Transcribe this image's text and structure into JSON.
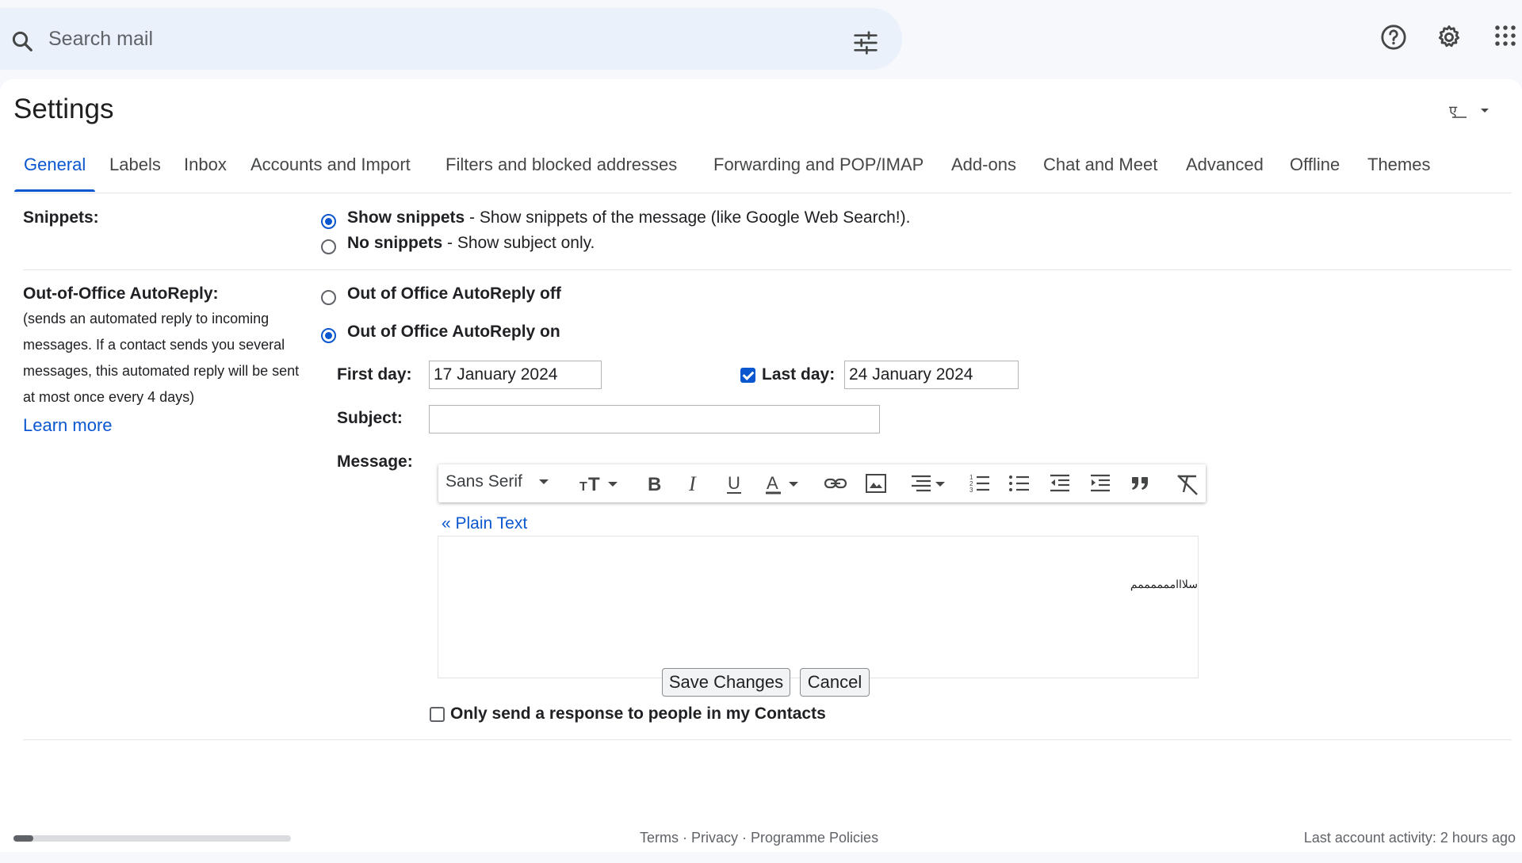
{
  "search": {
    "placeholder": "Search mail"
  },
  "header": {
    "icons": [
      "search-icon",
      "tune-icon",
      "help-icon",
      "gear-icon",
      "apps-icon"
    ]
  },
  "page": {
    "title": "Settings"
  },
  "tabs": [
    {
      "label": "General",
      "active": true
    },
    {
      "label": "Labels"
    },
    {
      "label": "Inbox"
    },
    {
      "label": "Accounts and Import"
    },
    {
      "label": "Filters and blocked addresses"
    },
    {
      "label": "Forwarding and POP/IMAP"
    },
    {
      "label": "Add-ons"
    },
    {
      "label": "Chat and Meet"
    },
    {
      "label": "Advanced"
    },
    {
      "label": "Offline"
    },
    {
      "label": "Themes"
    }
  ],
  "snippets": {
    "label": "Snippets:",
    "show": {
      "title": "Show snippets",
      "desc": " - Show snippets of the message (like Google Web Search!)."
    },
    "none": {
      "title": "No snippets",
      "desc": " - Show subject only."
    },
    "selected": "show"
  },
  "ooo": {
    "label": "Out-of-Office AutoReply:",
    "description": "(sends an automated reply to incoming messages. If a contact sends you several messages, this automated reply will be sent at most once every 4 days)",
    "learn_more": "Learn more",
    "off_label": "Out of Office AutoReply off",
    "on_label": "Out of Office AutoReply on",
    "selected": "on",
    "first_day_label": "First day:",
    "first_day": "17 January 2024",
    "last_day_label": "Last day:",
    "last_day": "24 January 2024",
    "last_day_checked": true,
    "subject_label": "Subject:",
    "subject": "",
    "message_label": "Message:",
    "font": "Sans Serif",
    "plain_text": "« Plain Text",
    "message_body": "سلاااممممممم",
    "contacts_only_label": "Only send a response to people in my Contacts",
    "contacts_only_checked": false
  },
  "buttons": {
    "save": "Save Changes",
    "cancel": "Cancel"
  },
  "footer": {
    "terms": "Terms",
    "privacy": "Privacy",
    "policies": "Programme Policies",
    "sep": " · ",
    "last_activity": "Last account activity: 2 hours ago"
  },
  "colors": {
    "accent": "#0b57d0",
    "background": "#f6f8fc",
    "search_bg": "#eaf1fb"
  }
}
